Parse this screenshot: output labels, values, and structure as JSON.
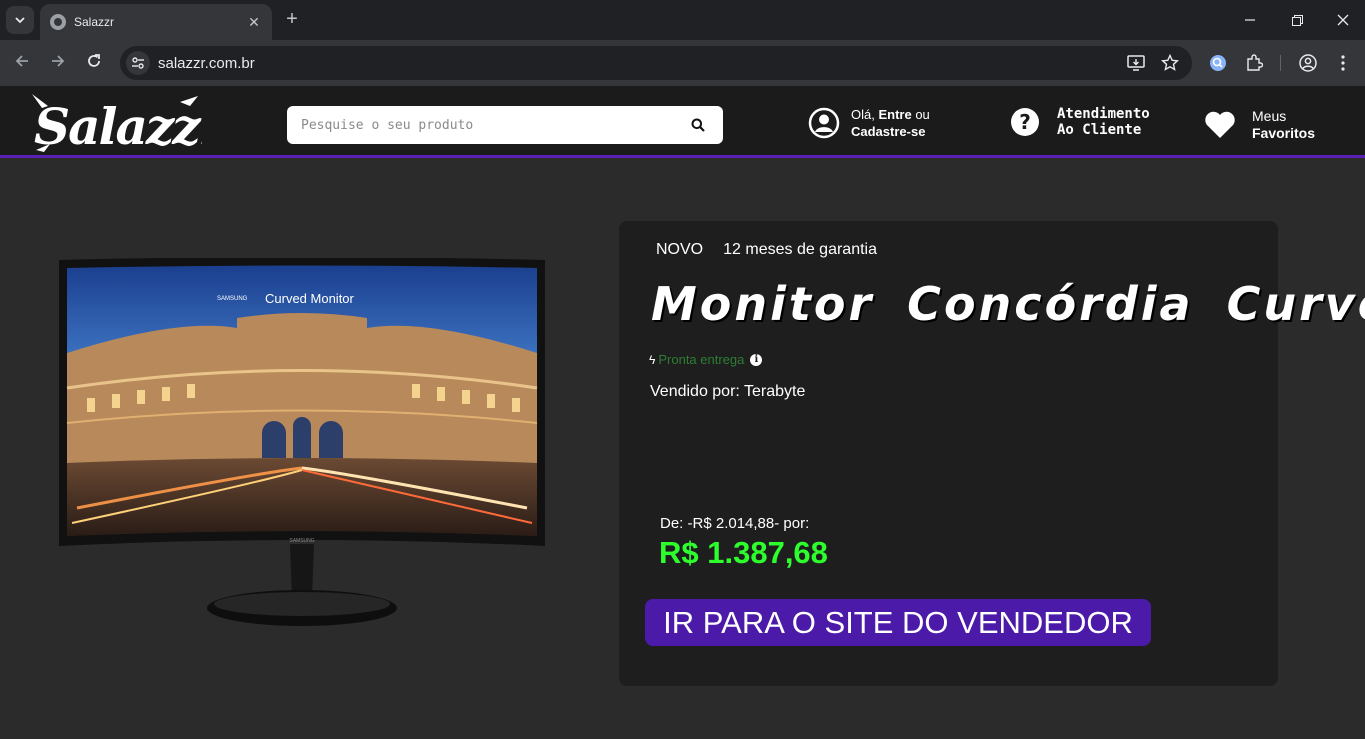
{
  "browser": {
    "tab_title": "Salazzr",
    "url": "salazzr.com.br"
  },
  "header": {
    "logo_text": "Salazzr",
    "search": {
      "placeholder": "Pesquise o seu produto",
      "value": ""
    },
    "account": {
      "greeting": "Olá,",
      "enter": "Entre",
      "or": "ou",
      "signup": "Cadastre-se"
    },
    "support": {
      "line1": "Atendimento",
      "line2": "Ao Cliente"
    },
    "favorites": {
      "line1": "Meus",
      "line2": "Favoritos"
    }
  },
  "product": {
    "image": {
      "brand_text": "SAMSUNG",
      "screen_caption": "Curved Monitor",
      "stand_brand": "SAMSUNG"
    },
    "condition": "NOVO",
    "warranty": "12 meses de garantia",
    "title": "Monitor Concórdia Curvo",
    "availability": "Pronta entrega",
    "seller": "Vendido por: Terabyte",
    "old_price": "De: -R$ 2.014,88- por:",
    "price": "R$ 1.387,68",
    "cta_label": "IR PARA O SITE DO VENDEDOR"
  },
  "colors": {
    "accent": "#5b21b6",
    "cta": "#4c1aa8",
    "price": "#2dff2d",
    "availability": "#2e7d32"
  },
  "icons": [
    "tab-search-icon",
    "chrome-favicon-icon",
    "close-icon",
    "plus-icon",
    "minimize-icon",
    "restore-icon",
    "back-icon",
    "forward-icon",
    "reload-icon",
    "site-settings-icon",
    "install-app-icon",
    "star-icon",
    "lens-extension-icon",
    "extensions-icon",
    "profile-icon",
    "kebab-menu-icon",
    "search-icon",
    "user-icon",
    "help-icon",
    "heart-icon",
    "bolt-icon",
    "info-icon"
  ]
}
